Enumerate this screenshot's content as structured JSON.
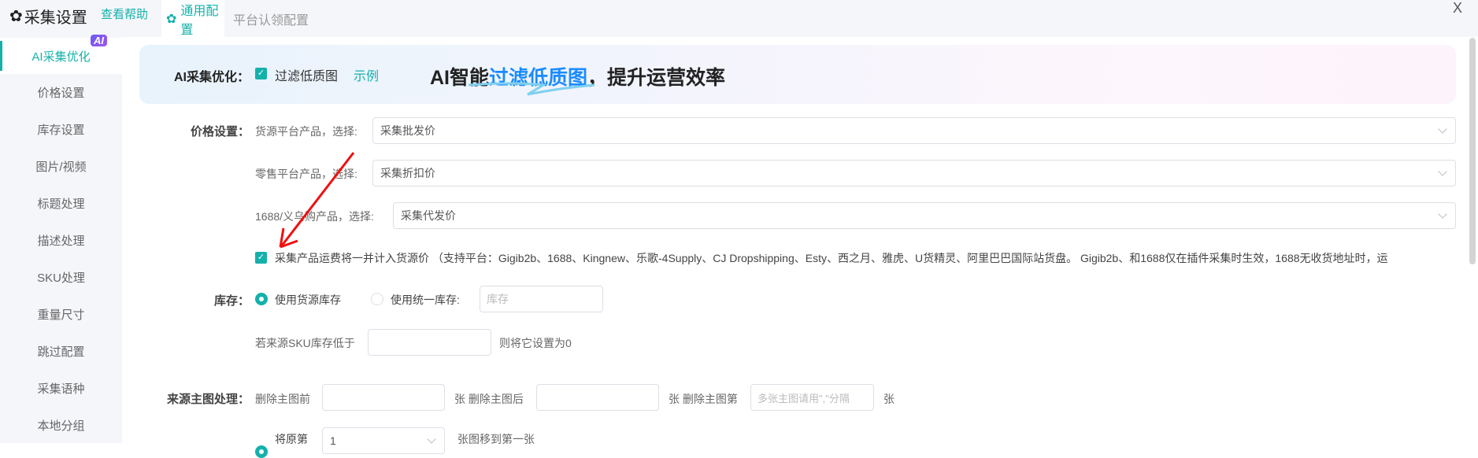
{
  "header": {
    "title": "采集设置",
    "help": "查看帮助",
    "tabs": [
      "通用配置",
      "平台认领配置"
    ],
    "close": "X"
  },
  "sidebar": {
    "items": [
      "AI采集优化",
      "价格设置",
      "库存设置",
      "图片/视频",
      "标题处理",
      "描述处理",
      "SKU处理",
      "重量尺寸",
      "跳过配置",
      "采集语种",
      "本地分组"
    ],
    "ai_badge": "AI"
  },
  "banner": {
    "label": "AI采集优化：",
    "checkbox": "过滤低质图",
    "example": "示例",
    "headline_pre": "AI智能",
    "headline_hl": "过滤低质图",
    "headline_post": "，提升运营效率"
  },
  "price": {
    "label": "价格设置：",
    "rows": [
      {
        "label": "货源平台产品，选择:",
        "value": "采集批发价"
      },
      {
        "label": "零售平台产品，选择:",
        "value": "采集折扣价"
      },
      {
        "label": "1688/义乌购产品，选择:",
        "value": "采集代发价"
      }
    ],
    "freight": "采集产品运费将一并计入货源价 （支持平台：Gigib2b、1688、Kingnew、乐歌-4Supply、CJ Dropshipping、Esty、西之月、雅虎、U货精灵、阿里巴巴国际站货盘。 Gigib2b、和1688仅在插件采集时生效，1688无收货地址时，运"
  },
  "stock": {
    "label": "库存：",
    "opt1": "使用货源库存",
    "opt2": "使用统一库存:",
    "placeholder": "库存",
    "sku_pre": "若来源SKU库存低于",
    "sku_post": "则将它设置为0"
  },
  "mainimg": {
    "label": "来源主图处理：",
    "del_front": "删除主图前",
    "del_back": "张 删除主图后",
    "del_nth": "张 删除主图第",
    "nth_placeholder": "多张主图请用\",\"分隔",
    "unit": "张",
    "move_pre": "将原第",
    "move_value": "1",
    "move_post": "张图移到第一张"
  }
}
